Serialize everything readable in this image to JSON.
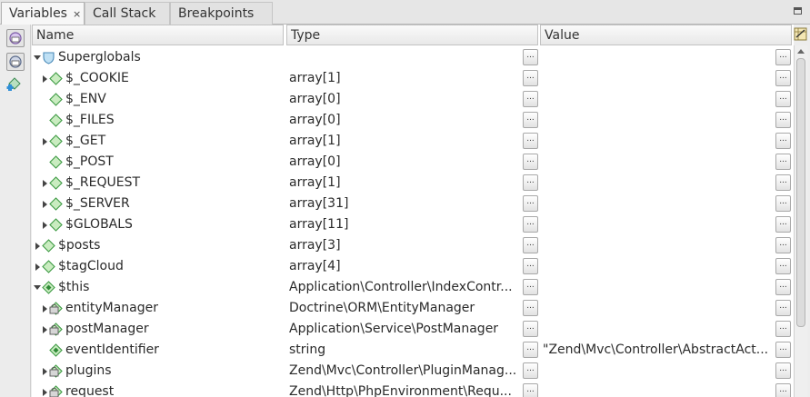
{
  "tabs": [
    {
      "label": "Variables",
      "active": true,
      "close": "×"
    },
    {
      "label": "Call Stack",
      "active": false
    },
    {
      "label": "Breakpoints",
      "active": false
    }
  ],
  "columns": {
    "name": "Name",
    "type": "Type",
    "value": "Value"
  },
  "detail_button": "...",
  "rows": [
    {
      "name": "Superglobals",
      "type": "",
      "value": "",
      "level": 0,
      "expander": "open",
      "icon": "shield-icon"
    },
    {
      "name": "$_COOKIE",
      "type": "array[1]",
      "value": "",
      "level": 1,
      "expander": "closed",
      "icon": "diamond-icon"
    },
    {
      "name": "$_ENV",
      "type": "array[0]",
      "value": "",
      "level": 1,
      "expander": "none",
      "icon": "diamond-icon"
    },
    {
      "name": "$_FILES",
      "type": "array[0]",
      "value": "",
      "level": 1,
      "expander": "none",
      "icon": "diamond-icon"
    },
    {
      "name": "$_GET",
      "type": "array[1]",
      "value": "",
      "level": 1,
      "expander": "closed",
      "icon": "diamond-icon"
    },
    {
      "name": "$_POST",
      "type": "array[0]",
      "value": "",
      "level": 1,
      "expander": "none",
      "icon": "diamond-icon"
    },
    {
      "name": "$_REQUEST",
      "type": "array[1]",
      "value": "",
      "level": 1,
      "expander": "closed",
      "icon": "diamond-icon"
    },
    {
      "name": "$_SERVER",
      "type": "array[31]",
      "value": "",
      "level": 1,
      "expander": "closed",
      "icon": "diamond-icon"
    },
    {
      "name": "$GLOBALS",
      "type": "array[11]",
      "value": "",
      "level": 1,
      "expander": "closed",
      "icon": "diamond-icon"
    },
    {
      "name": "$posts",
      "type": "array[3]",
      "value": "",
      "level": 0,
      "expander": "closed",
      "icon": "diamond-icon"
    },
    {
      "name": "$tagCloud",
      "type": "array[4]",
      "value": "",
      "level": 0,
      "expander": "closed",
      "icon": "diamond-icon"
    },
    {
      "name": "$this",
      "type": "Application\\Controller\\IndexContr...",
      "value": "",
      "level": 0,
      "expander": "open",
      "icon": "object-diamond-icon"
    },
    {
      "name": "entityManager",
      "type": "Doctrine\\ORM\\EntityManager",
      "value": "",
      "level": 1,
      "expander": "closed",
      "icon": "locked-field-icon"
    },
    {
      "name": "postManager",
      "type": "Application\\Service\\PostManager",
      "value": "",
      "level": 1,
      "expander": "closed",
      "icon": "locked-field-icon"
    },
    {
      "name": "eventIdentifier",
      "type": "string",
      "value": "\"Zend\\Mvc\\Controller\\AbstractAct...",
      "level": 1,
      "expander": "none",
      "icon": "object-diamond-icon"
    },
    {
      "name": "plugins",
      "type": "Zend\\Mvc\\Controller\\PluginManag...",
      "value": "",
      "level": 1,
      "expander": "closed",
      "icon": "locked-field-icon"
    },
    {
      "name": "request",
      "type": "Zend\\Http\\PhpEnvironment\\Requ...",
      "value": "",
      "level": 1,
      "expander": "closed",
      "icon": "locked-field-icon"
    }
  ]
}
